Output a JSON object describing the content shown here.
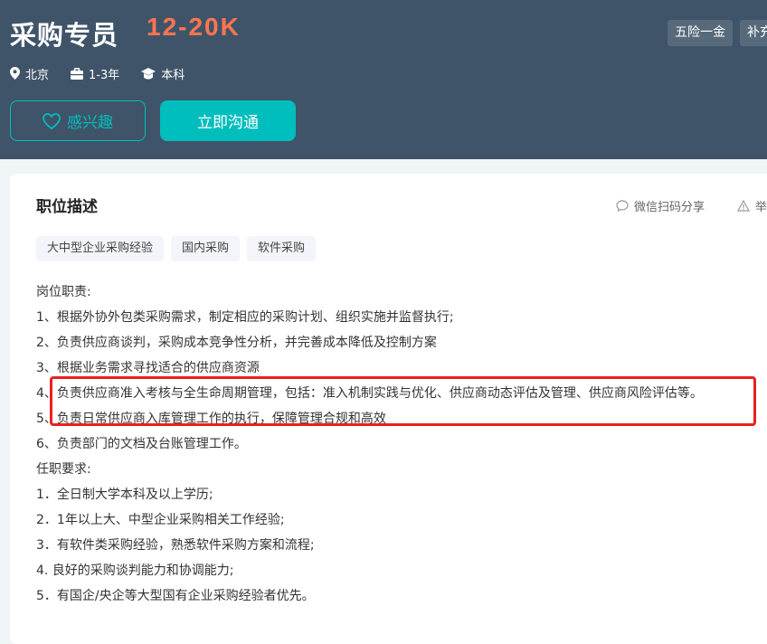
{
  "job": {
    "title": "采购专员",
    "salary": "12-20K",
    "location": "北京",
    "experience": "1-3年",
    "education": "本科"
  },
  "benefits": [
    "五险一金",
    "补充"
  ],
  "actions": {
    "interest_label": "感兴趣",
    "chat_label": "立即沟通"
  },
  "description": {
    "title": "职位描述",
    "share_label": "微信扫码分享",
    "report_label": "举",
    "skill_tags": [
      "大中型企业采购经验",
      "国内采购",
      "软件采购"
    ],
    "lines": [
      "岗位职责:",
      "1、根据外协外包类采购需求，制定相应的采购计划、组织实施并监督执行;",
      "2、负责供应商谈判，采购成本竞争性分析，并完善成本降低及控制方案",
      "3、根据业务需求寻找适合的供应商资源",
      "4、负责供应商准入考核与全生命周期管理，包括：准入机制实践与优化、供应商动态评估及管理、供应商风险评估等。",
      "5、负责日常供应商入库管理工作的执行，保障管理合规和高效",
      "6、负责部门的文档及台账管理工作。",
      "任职要求:",
      "1．全日制大学本科及以上学历;",
      "2．1年以上大、中型企业采购相关工作经验;",
      "3．有软件类采购经验，熟悉软件采购方案和流程;",
      "4.  良好的采购谈判能力和协调能力;",
      "5．有国企/央企等大型国有企业采购经验者优先。"
    ]
  },
  "colors": {
    "header_bg": "#3f5468",
    "salary": "#ff7552",
    "accent": "#00bebd",
    "highlight": "#e8211f"
  }
}
